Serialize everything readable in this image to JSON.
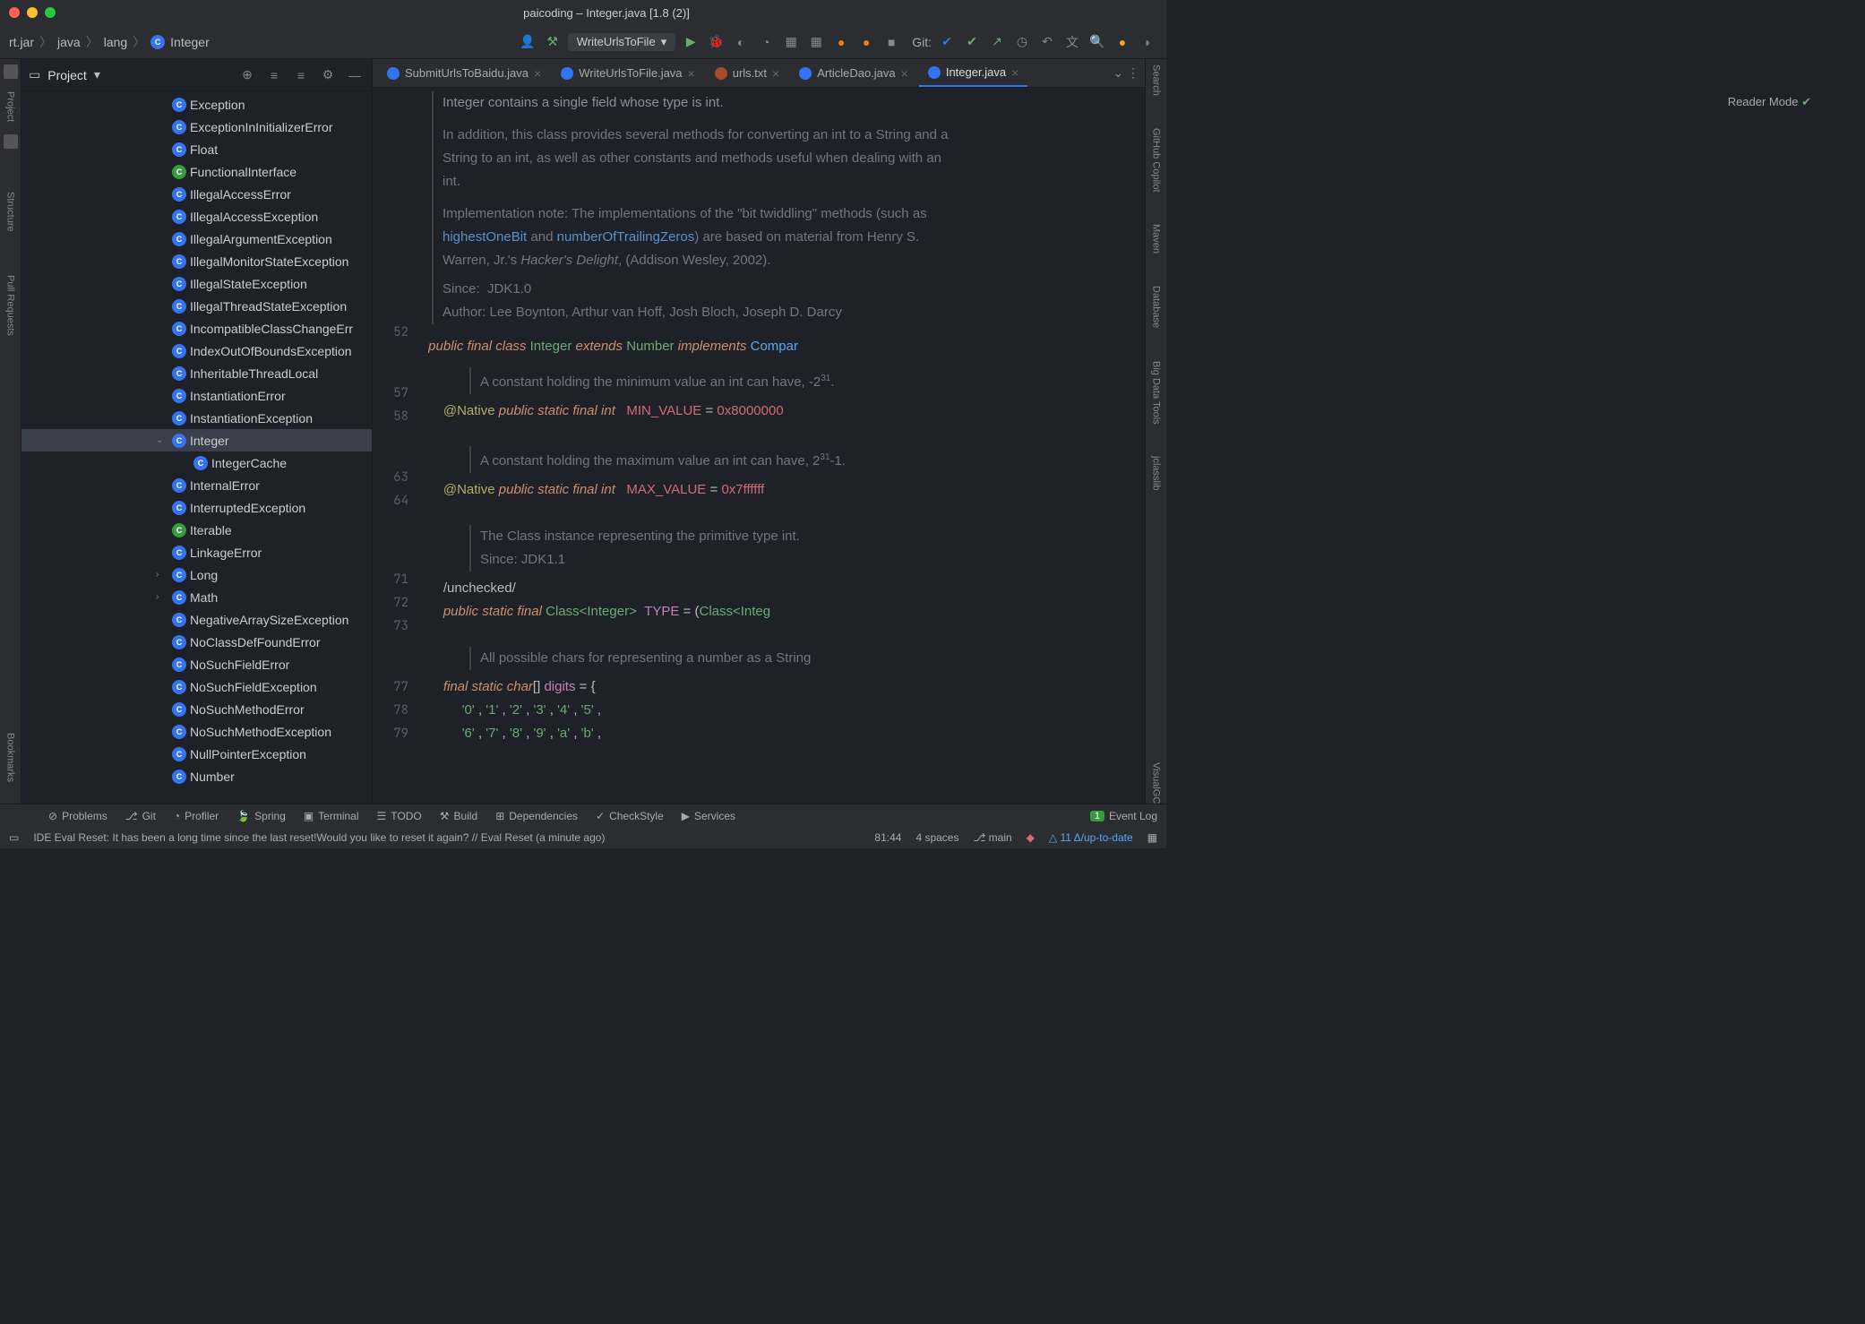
{
  "window": {
    "title": "paicoding – Integer.java [1.8 (2)]"
  },
  "breadcrumbs": [
    "rt.jar",
    "java",
    "lang",
    "Integer"
  ],
  "runConfig": "WriteUrlsToFile",
  "gitLabel": "Git:",
  "sidebar": {
    "title": "Project",
    "items": [
      {
        "label": "Exception"
      },
      {
        "label": "ExceptionInInitializerError"
      },
      {
        "label": "Float"
      },
      {
        "label": "FunctionalInterface",
        "green": true
      },
      {
        "label": "IllegalAccessError"
      },
      {
        "label": "IllegalAccessException"
      },
      {
        "label": "IllegalArgumentException"
      },
      {
        "label": "IllegalMonitorStateException"
      },
      {
        "label": "IllegalStateException"
      },
      {
        "label": "IllegalThreadStateException"
      },
      {
        "label": "IncompatibleClassChangeErr"
      },
      {
        "label": "IndexOutOfBoundsException"
      },
      {
        "label": "InheritableThreadLocal"
      },
      {
        "label": "InstantiationError"
      },
      {
        "label": "InstantiationException"
      },
      {
        "label": "Integer",
        "selected": true,
        "expandable": true,
        "expanded": true
      },
      {
        "label": "IntegerCache",
        "child": true
      },
      {
        "label": "InternalError"
      },
      {
        "label": "InterruptedException"
      },
      {
        "label": "Iterable",
        "green": true
      },
      {
        "label": "LinkageError"
      },
      {
        "label": "Long",
        "expandable": true
      },
      {
        "label": "Math",
        "expandable": true
      },
      {
        "label": "NegativeArraySizeException"
      },
      {
        "label": "NoClassDefFoundError"
      },
      {
        "label": "NoSuchFieldError"
      },
      {
        "label": "NoSuchFieldException"
      },
      {
        "label": "NoSuchMethodError"
      },
      {
        "label": "NoSuchMethodException"
      },
      {
        "label": "NullPointerException"
      },
      {
        "label": "Number"
      }
    ]
  },
  "tabs": [
    {
      "label": "SubmitUrlsToBaidu.java",
      "kind": "java"
    },
    {
      "label": "WriteUrlsToFile.java",
      "kind": "java"
    },
    {
      "label": "urls.txt",
      "kind": "txt"
    },
    {
      "label": "ArticleDao.java",
      "kind": "java"
    },
    {
      "label": "Integer.java",
      "kind": "java",
      "active": true
    }
  ],
  "readerMode": "Reader Mode",
  "leftStrip": [
    "Project",
    "Structure",
    "Pull Requests",
    "Bookmarks"
  ],
  "rightStrip": [
    "Search",
    "GitHub Copilot",
    "Maven",
    "Database",
    "Big Data Tools",
    "jclasslib",
    "VisualGC"
  ],
  "code": {
    "doc1_l1": "Integer contains a single field whose type is int.",
    "doc1_l2": "In addition, this class provides several methods for converting an int to a String and a",
    "doc1_l3": "String to an int, as well as other constants and methods useful when dealing with an",
    "doc1_l4": "int.",
    "doc1_l5a": "Implementation note: The implementations of the \"bit twiddling\" methods (such as ",
    "doc1_hob": "highestOneBit",
    "doc1_and": " and ",
    "doc1_notz": "numberOfTrailingZeros",
    "doc1_l5b": ") are based on material from Henry S.",
    "doc1_l6": "Warren, Jr.'s Hacker's Delight, (Addison Wesley, 2002).",
    "doc1_since_l": "Since:",
    "doc1_since_v": "JDK1.0",
    "doc1_author_l": "Author:",
    "doc1_author_v": "Lee Boynton, Arthur van Hoff, Josh Bloch, Joseph D. Darcy",
    "ln52": "52",
    "ln57": "57",
    "ln58": "58",
    "ln63": "63",
    "ln64": "64",
    "ln71": "71",
    "ln72": "72",
    "ln73": "73",
    "ln77": "77",
    "ln78": "78",
    "ln79": "79",
    "classDecl": {
      "public": "public",
      "final": "final",
      "class": "class",
      "Integer": "Integer",
      "extends": "extends",
      "Number": "Number",
      "implements": "implements",
      "Compar": "Compar"
    },
    "doc_min": "A constant holding the minimum value an int can have, -2",
    "doc_min_exp": "31",
    "doc_min_tail": ".",
    "native": "@Native",
    "public": "public",
    "static": "static",
    "final": "final",
    "int": "int",
    "MIN_VALUE": "MIN_VALUE",
    "eq": "=",
    "minv": "0x8000000",
    "doc_max": "A constant holding the maximum value an int can have, 2",
    "doc_max_exp": "31",
    "doc_max_tail": "-1.",
    "MAX_VALUE": "MAX_VALUE",
    "maxv": "0x7ffffff",
    "doc_type": "The Class instance representing the primitive type int.",
    "doc_type_since_l": "Since:",
    "doc_type_since_v": "JDK1.1",
    "unchecked": "/unchecked/",
    "ClassInteger": "Class<Integer>",
    "TYPE": "TYPE",
    "paren": "(",
    "ClassInteg": "Class<Integ",
    "doc_digits": "All possible chars for representing a number as a String",
    "char": "char",
    "brackets": "[]",
    "digits": "digits",
    "brace": "{",
    "row1": [
      "'0'",
      "'1'",
      "'2'",
      "'3'",
      "'4'",
      "'5'"
    ],
    "row2": [
      "'6'",
      "'7'",
      "'8'",
      "'9'",
      "'a'",
      "'b'"
    ]
  },
  "bottomBar": [
    "Problems",
    "Git",
    "Profiler",
    "Spring",
    "Terminal",
    "TODO",
    "Build",
    "Dependencies",
    "CheckStyle",
    "Services"
  ],
  "eventLog": "Event Log",
  "statusBar": {
    "msg": "IDE Eval Reset: It has been a long time since the last reset!Would you like to reset it again? // Eval Reset (a minute ago)",
    "pos": "81:44",
    "indent": "4 spaces",
    "branch": "main",
    "delta": "11 Δ/up-to-date"
  }
}
